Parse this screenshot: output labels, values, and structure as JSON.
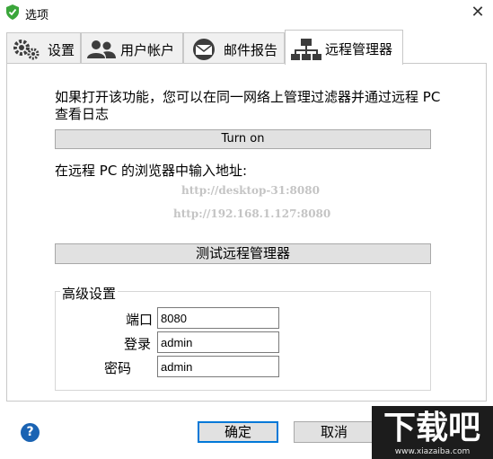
{
  "window": {
    "title": "选项",
    "close_glyph": "✕"
  },
  "tabs": [
    {
      "label": "设置",
      "icon": "gears-icon",
      "active": false
    },
    {
      "label": "用户帐户",
      "icon": "users-icon",
      "active": false
    },
    {
      "label": "邮件报告",
      "icon": "mail-icon",
      "active": false
    },
    {
      "label": "远程管理器",
      "icon": "network-icon",
      "active": true
    }
  ],
  "remote": {
    "description": "如果打开该功能，您可以在同一网络上管理过滤器并通过远程 PC 查看日志",
    "turn_on_label": "Turn on",
    "url_prompt": "在远程 PC 的浏览器中输入地址:",
    "url_hostname": "http://desktop-31:8080",
    "url_ip": "http://192.168.1.127:8080",
    "test_label": "测试远程管理器"
  },
  "advanced": {
    "title": "高级设置",
    "port_label": "端口",
    "port_value": "8080",
    "login_label": "登录",
    "login_value": "admin",
    "password_label": "密码",
    "password_value": "admin"
  },
  "footer": {
    "help_glyph": "?",
    "ok_label": "确定",
    "cancel_label": "取消"
  },
  "watermark": {
    "logo_text": "下载吧",
    "url": "www.xiazaiba.com"
  },
  "colors": {
    "accent": "#0078d7",
    "shield_green": "#3aa63a",
    "icon_dark": "#3d3d3d",
    "url_grey": "#c4c4c4"
  }
}
